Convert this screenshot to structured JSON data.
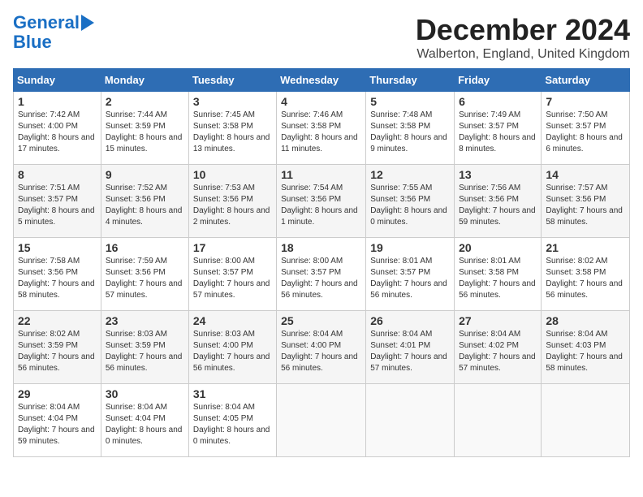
{
  "logo": {
    "line1": "General",
    "line2": "Blue"
  },
  "title": "December 2024",
  "location": "Walberton, England, United Kingdom",
  "days_of_week": [
    "Sunday",
    "Monday",
    "Tuesday",
    "Wednesday",
    "Thursday",
    "Friday",
    "Saturday"
  ],
  "weeks": [
    [
      {
        "day": "1",
        "info": "Sunrise: 7:42 AM\nSunset: 4:00 PM\nDaylight: 8 hours and 17 minutes."
      },
      {
        "day": "2",
        "info": "Sunrise: 7:44 AM\nSunset: 3:59 PM\nDaylight: 8 hours and 15 minutes."
      },
      {
        "day": "3",
        "info": "Sunrise: 7:45 AM\nSunset: 3:58 PM\nDaylight: 8 hours and 13 minutes."
      },
      {
        "day": "4",
        "info": "Sunrise: 7:46 AM\nSunset: 3:58 PM\nDaylight: 8 hours and 11 minutes."
      },
      {
        "day": "5",
        "info": "Sunrise: 7:48 AM\nSunset: 3:58 PM\nDaylight: 8 hours and 9 minutes."
      },
      {
        "day": "6",
        "info": "Sunrise: 7:49 AM\nSunset: 3:57 PM\nDaylight: 8 hours and 8 minutes."
      },
      {
        "day": "7",
        "info": "Sunrise: 7:50 AM\nSunset: 3:57 PM\nDaylight: 8 hours and 6 minutes."
      }
    ],
    [
      {
        "day": "8",
        "info": "Sunrise: 7:51 AM\nSunset: 3:57 PM\nDaylight: 8 hours and 5 minutes."
      },
      {
        "day": "9",
        "info": "Sunrise: 7:52 AM\nSunset: 3:56 PM\nDaylight: 8 hours and 4 minutes."
      },
      {
        "day": "10",
        "info": "Sunrise: 7:53 AM\nSunset: 3:56 PM\nDaylight: 8 hours and 2 minutes."
      },
      {
        "day": "11",
        "info": "Sunrise: 7:54 AM\nSunset: 3:56 PM\nDaylight: 8 hours and 1 minute."
      },
      {
        "day": "12",
        "info": "Sunrise: 7:55 AM\nSunset: 3:56 PM\nDaylight: 8 hours and 0 minutes."
      },
      {
        "day": "13",
        "info": "Sunrise: 7:56 AM\nSunset: 3:56 PM\nDaylight: 7 hours and 59 minutes."
      },
      {
        "day": "14",
        "info": "Sunrise: 7:57 AM\nSunset: 3:56 PM\nDaylight: 7 hours and 58 minutes."
      }
    ],
    [
      {
        "day": "15",
        "info": "Sunrise: 7:58 AM\nSunset: 3:56 PM\nDaylight: 7 hours and 58 minutes."
      },
      {
        "day": "16",
        "info": "Sunrise: 7:59 AM\nSunset: 3:56 PM\nDaylight: 7 hours and 57 minutes."
      },
      {
        "day": "17",
        "info": "Sunrise: 8:00 AM\nSunset: 3:57 PM\nDaylight: 7 hours and 57 minutes."
      },
      {
        "day": "18",
        "info": "Sunrise: 8:00 AM\nSunset: 3:57 PM\nDaylight: 7 hours and 56 minutes."
      },
      {
        "day": "19",
        "info": "Sunrise: 8:01 AM\nSunset: 3:57 PM\nDaylight: 7 hours and 56 minutes."
      },
      {
        "day": "20",
        "info": "Sunrise: 8:01 AM\nSunset: 3:58 PM\nDaylight: 7 hours and 56 minutes."
      },
      {
        "day": "21",
        "info": "Sunrise: 8:02 AM\nSunset: 3:58 PM\nDaylight: 7 hours and 56 minutes."
      }
    ],
    [
      {
        "day": "22",
        "info": "Sunrise: 8:02 AM\nSunset: 3:59 PM\nDaylight: 7 hours and 56 minutes."
      },
      {
        "day": "23",
        "info": "Sunrise: 8:03 AM\nSunset: 3:59 PM\nDaylight: 7 hours and 56 minutes."
      },
      {
        "day": "24",
        "info": "Sunrise: 8:03 AM\nSunset: 4:00 PM\nDaylight: 7 hours and 56 minutes."
      },
      {
        "day": "25",
        "info": "Sunrise: 8:04 AM\nSunset: 4:00 PM\nDaylight: 7 hours and 56 minutes."
      },
      {
        "day": "26",
        "info": "Sunrise: 8:04 AM\nSunset: 4:01 PM\nDaylight: 7 hours and 57 minutes."
      },
      {
        "day": "27",
        "info": "Sunrise: 8:04 AM\nSunset: 4:02 PM\nDaylight: 7 hours and 57 minutes."
      },
      {
        "day": "28",
        "info": "Sunrise: 8:04 AM\nSunset: 4:03 PM\nDaylight: 7 hours and 58 minutes."
      }
    ],
    [
      {
        "day": "29",
        "info": "Sunrise: 8:04 AM\nSunset: 4:04 PM\nDaylight: 7 hours and 59 minutes."
      },
      {
        "day": "30",
        "info": "Sunrise: 8:04 AM\nSunset: 4:04 PM\nDaylight: 8 hours and 0 minutes."
      },
      {
        "day": "31",
        "info": "Sunrise: 8:04 AM\nSunset: 4:05 PM\nDaylight: 8 hours and 0 minutes."
      },
      null,
      null,
      null,
      null
    ]
  ]
}
